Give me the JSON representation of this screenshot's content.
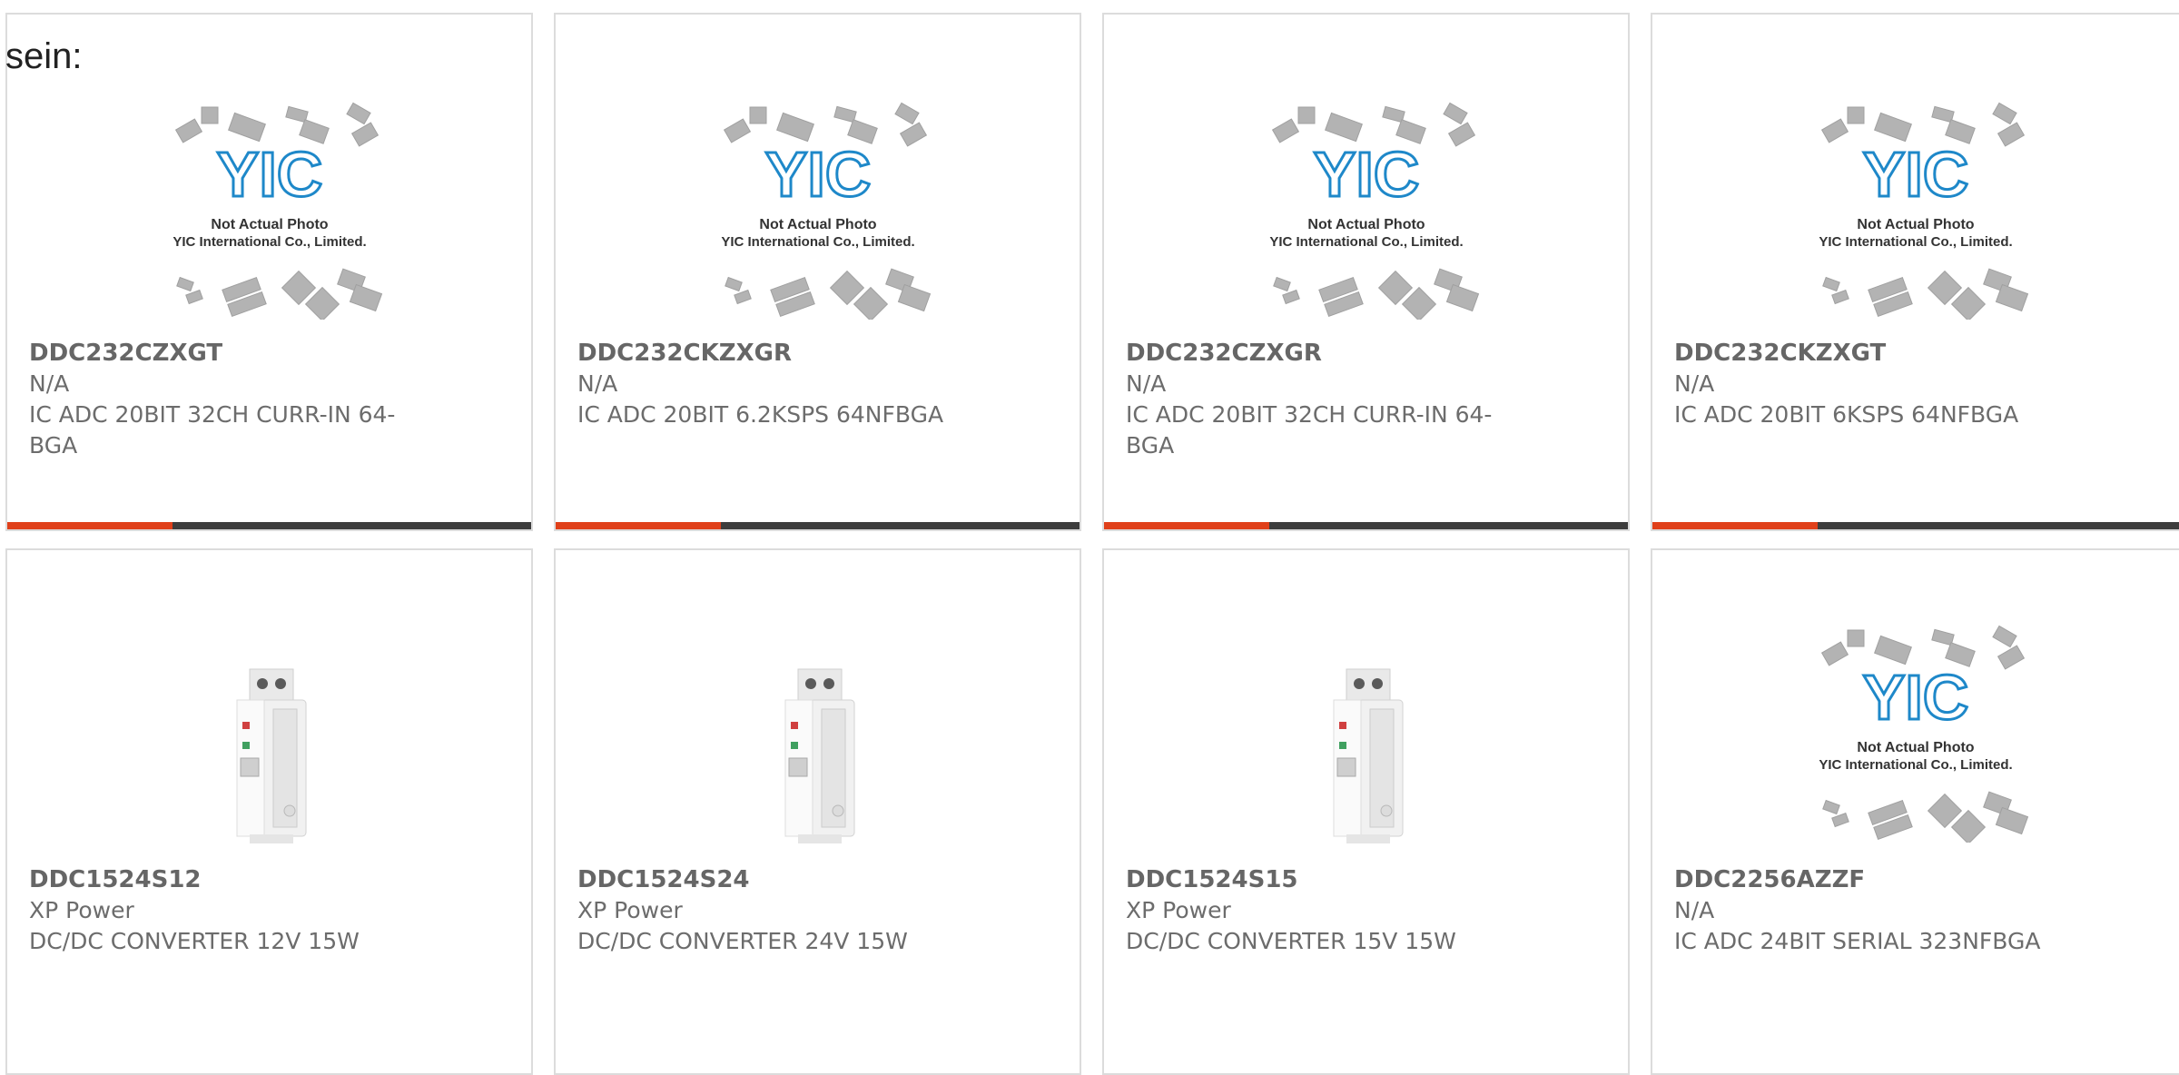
{
  "lead_text": "sein:",
  "placeholder": {
    "logo_text": "YIC",
    "caption_1": "Not Actual Photo",
    "caption_2": "YIC International Co., Limited."
  },
  "colors": {
    "accent": "#e0401a",
    "bar_dark": "#3d3d3d",
    "card_border": "#dcdcdc",
    "text": "#6c6c6c"
  },
  "products": [
    {
      "part": "DDC232CZXGT",
      "mfr": "N/A",
      "desc": "IC ADC 20BIT 32CH CURR-IN 64-BGA",
      "image": "yic-placeholder"
    },
    {
      "part": "DDC232CKZXGR",
      "mfr": "N/A",
      "desc": "IC ADC 20BIT 6.2KSPS 64NFBGA",
      "image": "yic-placeholder"
    },
    {
      "part": "DDC232CZXGR",
      "mfr": "N/A",
      "desc": "IC ADC 20BIT 32CH CURR-IN 64-BGA",
      "image": "yic-placeholder"
    },
    {
      "part": "DDC232CKZXGT",
      "mfr": "N/A",
      "desc": "IC ADC 20BIT 6KSPS 64NFBGA",
      "image": "yic-placeholder"
    },
    {
      "part": "DDC1524S12",
      "mfr": "XP Power",
      "desc": "DC/DC CONVERTER 12V 15W",
      "image": "din-rail-power-supply"
    },
    {
      "part": "DDC1524S24",
      "mfr": "XP Power",
      "desc": "DC/DC CONVERTER 24V 15W",
      "image": "din-rail-power-supply"
    },
    {
      "part": "DDC1524S15",
      "mfr": "XP Power",
      "desc": "DC/DC CONVERTER 15V 15W",
      "image": "din-rail-power-supply"
    },
    {
      "part": "DDC2256AZZF",
      "mfr": "N/A",
      "desc": "IC ADC 24BIT SERIAL 323NFBGA",
      "image": "yic-placeholder"
    }
  ]
}
